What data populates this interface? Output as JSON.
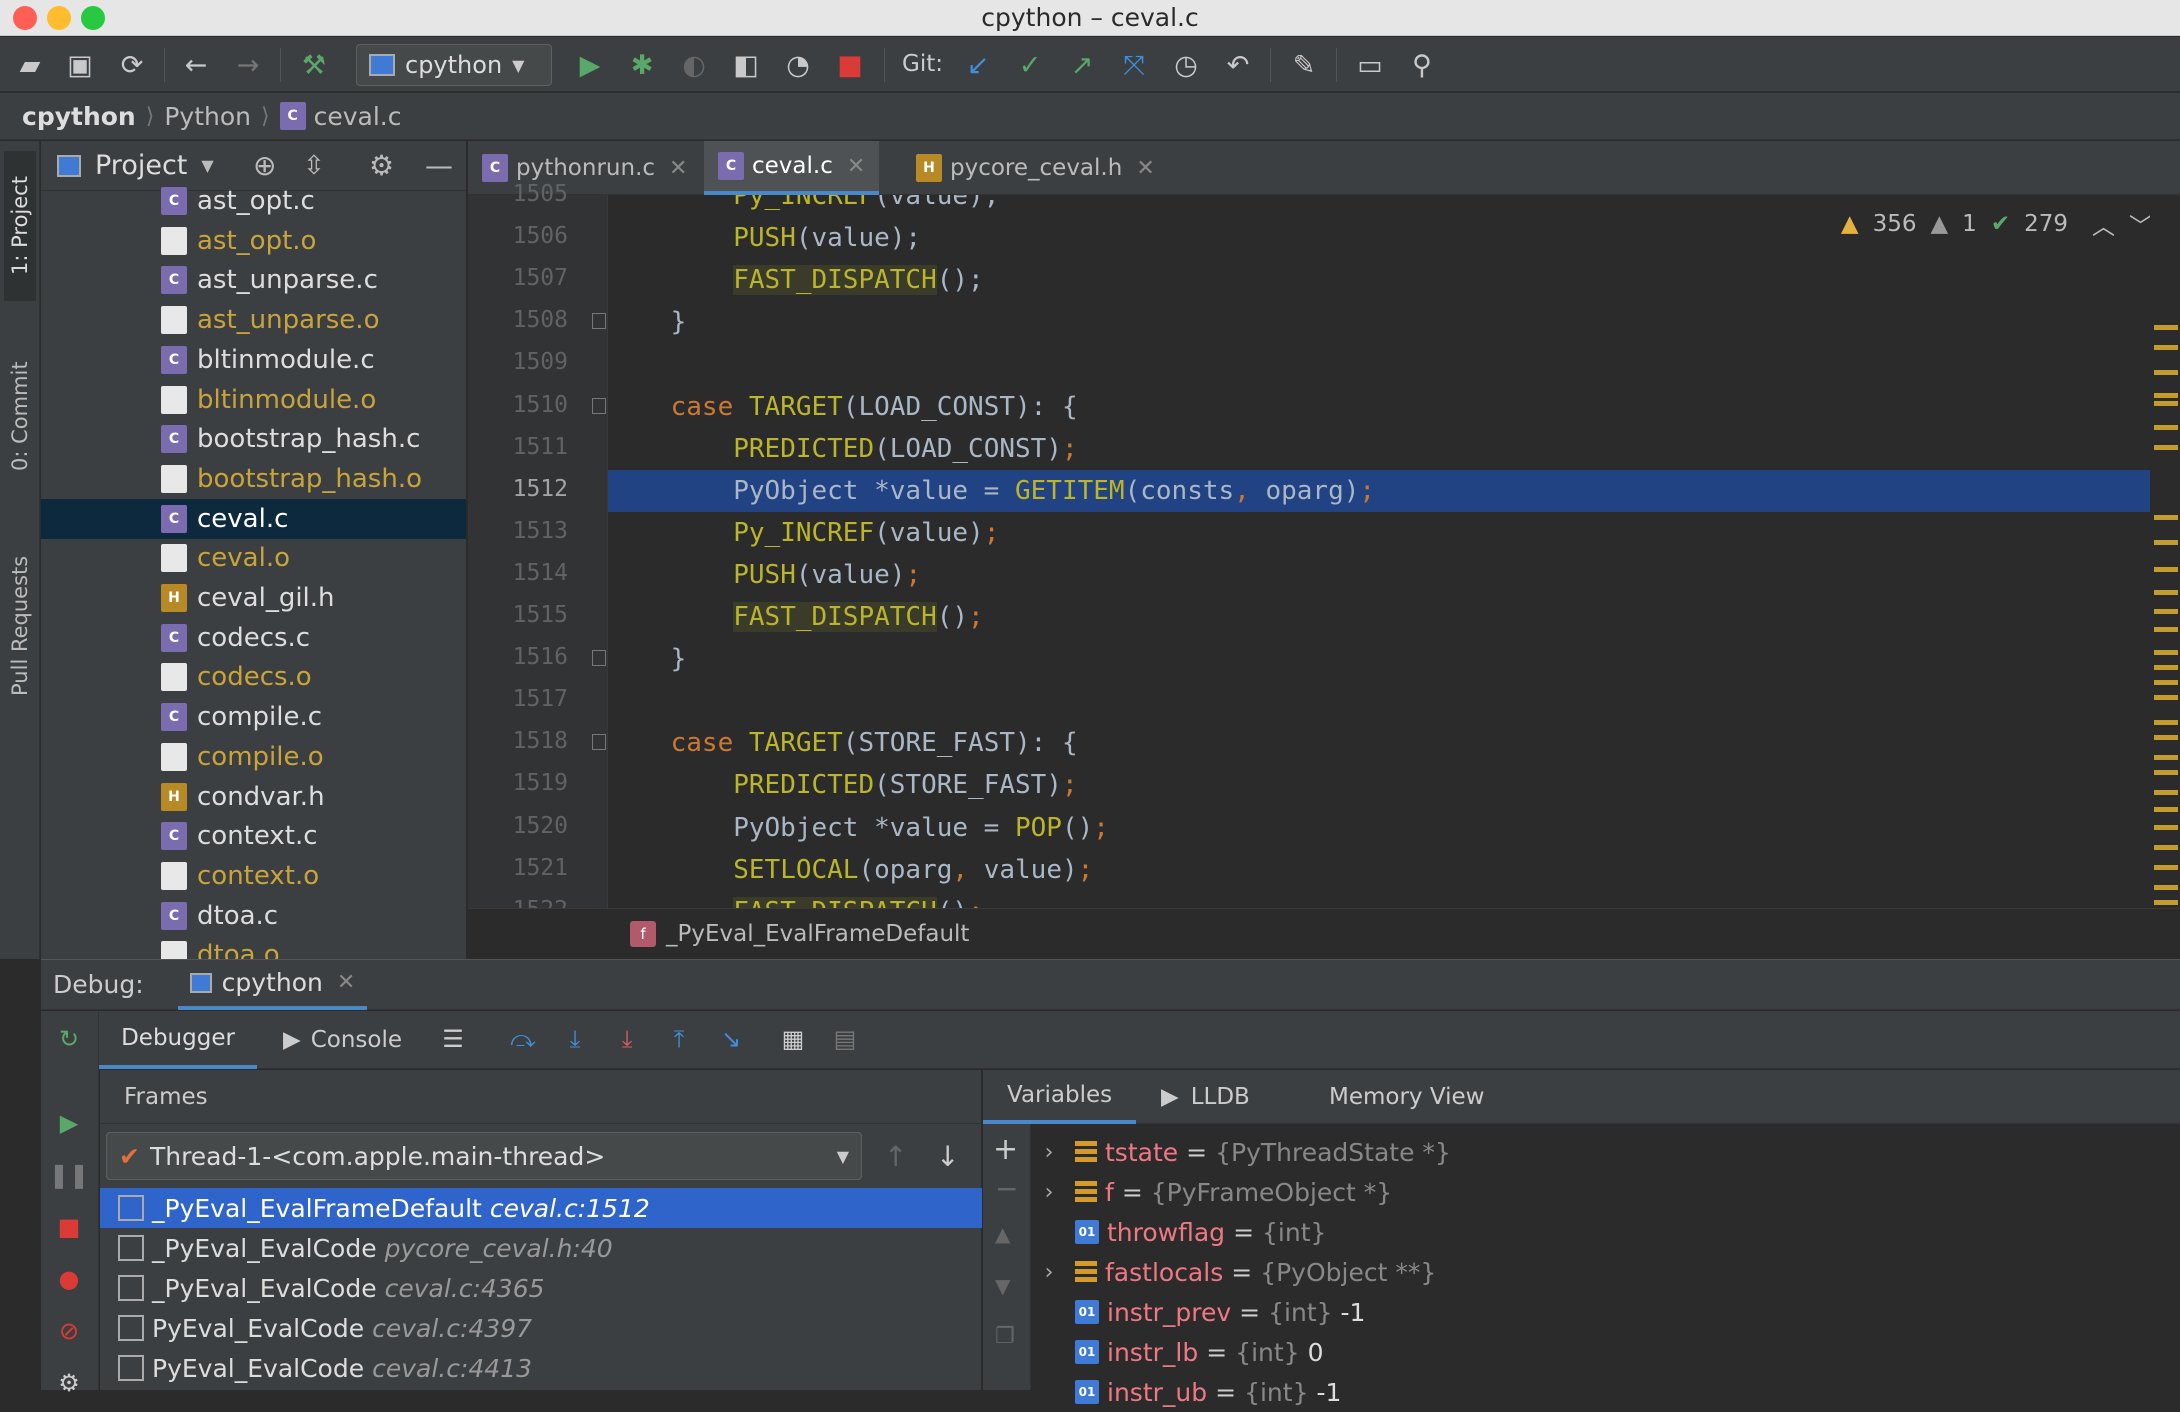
{
  "window": {
    "title": "cpython – ceval.c"
  },
  "toolbar": {
    "run_config": "cpython",
    "git_label": "Git:"
  },
  "breadcrumb": {
    "project": "cpython",
    "folder": "Python",
    "file": "ceval.c"
  },
  "left_strip": {
    "project_tab": "1: Project",
    "commit_tab": "0: Commit",
    "pull_requests_tab": "Pull Requests"
  },
  "project_panel": {
    "title": "Project",
    "files": [
      {
        "name": "ast_opt.c",
        "kind": "c"
      },
      {
        "name": "ast_opt.o",
        "kind": "o"
      },
      {
        "name": "ast_unparse.c",
        "kind": "c"
      },
      {
        "name": "ast_unparse.o",
        "kind": "o"
      },
      {
        "name": "bltinmodule.c",
        "kind": "c"
      },
      {
        "name": "bltinmodule.o",
        "kind": "o"
      },
      {
        "name": "bootstrap_hash.c",
        "kind": "c"
      },
      {
        "name": "bootstrap_hash.o",
        "kind": "o"
      },
      {
        "name": "ceval.c",
        "kind": "c",
        "selected": true
      },
      {
        "name": "ceval.o",
        "kind": "o"
      },
      {
        "name": "ceval_gil.h",
        "kind": "h"
      },
      {
        "name": "codecs.c",
        "kind": "c"
      },
      {
        "name": "codecs.o",
        "kind": "o"
      },
      {
        "name": "compile.c",
        "kind": "c"
      },
      {
        "name": "compile.o",
        "kind": "o"
      },
      {
        "name": "condvar.h",
        "kind": "h"
      },
      {
        "name": "context.c",
        "kind": "c"
      },
      {
        "name": "context.o",
        "kind": "o"
      },
      {
        "name": "dtoa.c",
        "kind": "c"
      },
      {
        "name": "dtoa.o",
        "kind": "o"
      }
    ]
  },
  "editor_tabs": [
    {
      "label": "pythonrun.c",
      "kind": "c"
    },
    {
      "label": "ceval.c",
      "kind": "c",
      "active": true
    },
    {
      "label": "pycore_ceval.h",
      "kind": "h"
    }
  ],
  "inspections": {
    "warnings": "356",
    "weak_warnings": "1",
    "ok": "279"
  },
  "code": {
    "current_line": "1512",
    "lines": [
      {
        "n": "1505",
        "html": "        <span class='mac'>Py_INCREF</span>(value);"
      },
      {
        "n": "1506",
        "html": "        <span class='mac'>PUSH</span>(value);"
      },
      {
        "n": "1507",
        "html": "        <span class='macbg'>FAST_DISPATCH</span>();"
      },
      {
        "n": "1508",
        "html": "    }"
      },
      {
        "n": "1509",
        "html": ""
      },
      {
        "n": "1510",
        "html": "    <span class='kw'>case</span> <span class='mac'>TARGET</span>(LOAD_CONST): {"
      },
      {
        "n": "1511",
        "html": "        <span class='mac'>PREDICTED</span>(LOAD_CONST)<span class='kw'>;</span>"
      },
      {
        "n": "1512",
        "html": "        PyObject *value = <span class='mac'>GETITEM</span>(consts<span class='kw'>,</span> oparg)<span class='kw'>;</span>"
      },
      {
        "n": "1513",
        "html": "        <span class='mac'>Py_INCREF</span>(value)<span class='kw'>;</span>"
      },
      {
        "n": "1514",
        "html": "        <span class='mac'>PUSH</span>(value)<span class='kw'>;</span>"
      },
      {
        "n": "1515",
        "html": "        <span class='macbg'>FAST_DISPATCH</span>()<span class='kw'>;</span>"
      },
      {
        "n": "1516",
        "html": "    }"
      },
      {
        "n": "1517",
        "html": ""
      },
      {
        "n": "1518",
        "html": "    <span class='kw'>case</span> <span class='mac'>TARGET</span>(STORE_FAST): {"
      },
      {
        "n": "1519",
        "html": "        <span class='mac'>PREDICTED</span>(STORE_FAST)<span class='kw'>;</span>"
      },
      {
        "n": "1520",
        "html": "        PyObject *value = <span class='mac'>POP</span>()<span class='kw'>;</span>"
      },
      {
        "n": "1521",
        "html": "        <span class='mac'>SETLOCAL</span>(oparg<span class='kw'>,</span> value)<span class='kw'>;</span>"
      },
      {
        "n": "1522",
        "html": "        <span class='macbg'>FAST_DISPATCH</span>()<span class='kw'>;</span>"
      }
    ]
  },
  "editor_breadcrumb": {
    "function": "_PyEval_EvalFrameDefault"
  },
  "debug": {
    "label": "Debug:",
    "session": "cpython",
    "tabs": {
      "debugger": "Debugger",
      "console": "Console"
    },
    "frames_title": "Frames",
    "thread": "Thread-1-<com.apple.main-thread>",
    "frames": [
      {
        "name": "_PyEval_EvalFrameDefault",
        "loc": "ceval.c:1512",
        "selected": true
      },
      {
        "name": "_PyEval_EvalCode",
        "loc": "pycore_ceval.h:40"
      },
      {
        "name": "_PyEval_EvalCode",
        "loc": "ceval.c:4365"
      },
      {
        "name": "PyEval_EvalCode",
        "loc": "ceval.c:4397"
      },
      {
        "name": "PyEval_EvalCode",
        "loc": "ceval.c:4413"
      }
    ],
    "var_tabs": {
      "variables": "Variables",
      "lldb": "LLDB",
      "memory": "Memory View"
    },
    "variables": [
      {
        "name": "tstate",
        "type": "{PyThreadState *}",
        "value": "",
        "icon": "array",
        "expandable": true
      },
      {
        "name": "f",
        "type": "{PyFrameObject *}",
        "value": "",
        "icon": "array",
        "expandable": true
      },
      {
        "name": "throwflag",
        "type": "{int}",
        "value": "",
        "icon": "01",
        "expandable": false
      },
      {
        "name": "fastlocals",
        "type": "{PyObject **}",
        "value": "",
        "icon": "array",
        "expandable": true
      },
      {
        "name": "instr_prev",
        "type": "{int}",
        "value": "-1",
        "icon": "01",
        "expandable": false
      },
      {
        "name": "instr_lb",
        "type": "{int}",
        "value": "0",
        "icon": "01",
        "expandable": false
      },
      {
        "name": "instr_ub",
        "type": "{int}",
        "value": "-1",
        "icon": "01",
        "expandable": false
      }
    ]
  },
  "colors": {
    "accent": "#4a88c7",
    "selection": "#2f65ca",
    "current_line": "#214283",
    "warning": "#c39b2f"
  }
}
